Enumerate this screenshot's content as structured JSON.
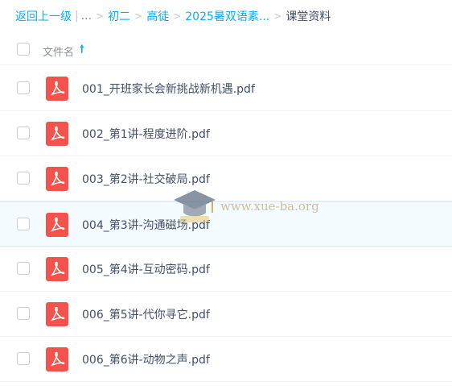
{
  "breadcrumb": {
    "back": "返回上一级",
    "ellipsis": "...",
    "items": [
      "初二",
      "高徒",
      "2025暑双语素..."
    ],
    "current": "课堂资料"
  },
  "header": {
    "name_label": "文件名",
    "sort_icon": "arrow-up-icon"
  },
  "files": [
    {
      "name": "001_开班家长会新挑战新机遇.pdf",
      "icon": "pdf-icon"
    },
    {
      "name": "002_第1讲-程度进阶.pdf",
      "icon": "pdf-icon"
    },
    {
      "name": "003_第2讲-社交破局.pdf",
      "icon": "pdf-icon"
    },
    {
      "name": "004_第3讲-沟通磁场.pdf",
      "icon": "pdf-icon"
    },
    {
      "name": "005_第4讲-互动密码.pdf",
      "icon": "pdf-icon"
    },
    {
      "name": "006_第5讲-代你寻它.pdf",
      "icon": "pdf-icon"
    },
    {
      "name": "006_第6讲-动物之声.pdf",
      "icon": "pdf-icon"
    }
  ],
  "watermark": {
    "text": "www.xue-ba.org"
  },
  "colors": {
    "link": "#09aaff",
    "pdf": "#f4524d",
    "hover_row": "#f4fbff"
  }
}
